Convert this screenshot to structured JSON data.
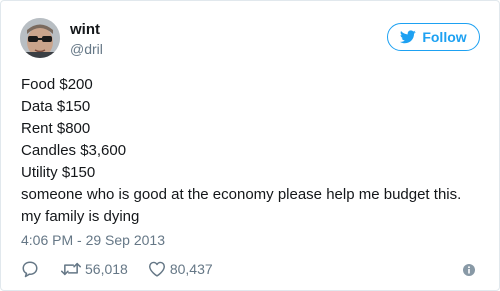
{
  "user": {
    "display_name": "wint",
    "handle": "@dril"
  },
  "follow_button": {
    "label": "Follow",
    "icon": "twitter-bird-icon"
  },
  "tweet": {
    "lines": [
      "Food $200",
      "Data $150",
      "Rent $800",
      "Candles $3,600",
      "Utility $150",
      "someone who is good at the economy please help me budget this. my family is dying"
    ],
    "timestamp": "4:06 PM - 29 Sep 2013"
  },
  "actions": {
    "reply_icon": "reply-icon",
    "retweet_icon": "retweet-icon",
    "retweet_count": "56,018",
    "like_icon": "heart-icon",
    "like_count": "80,437",
    "info_icon": "info-icon"
  },
  "colors": {
    "accent": "#1da1f2",
    "text_primary": "#14171a",
    "text_secondary": "#657786",
    "border": "#e1e8ed"
  }
}
